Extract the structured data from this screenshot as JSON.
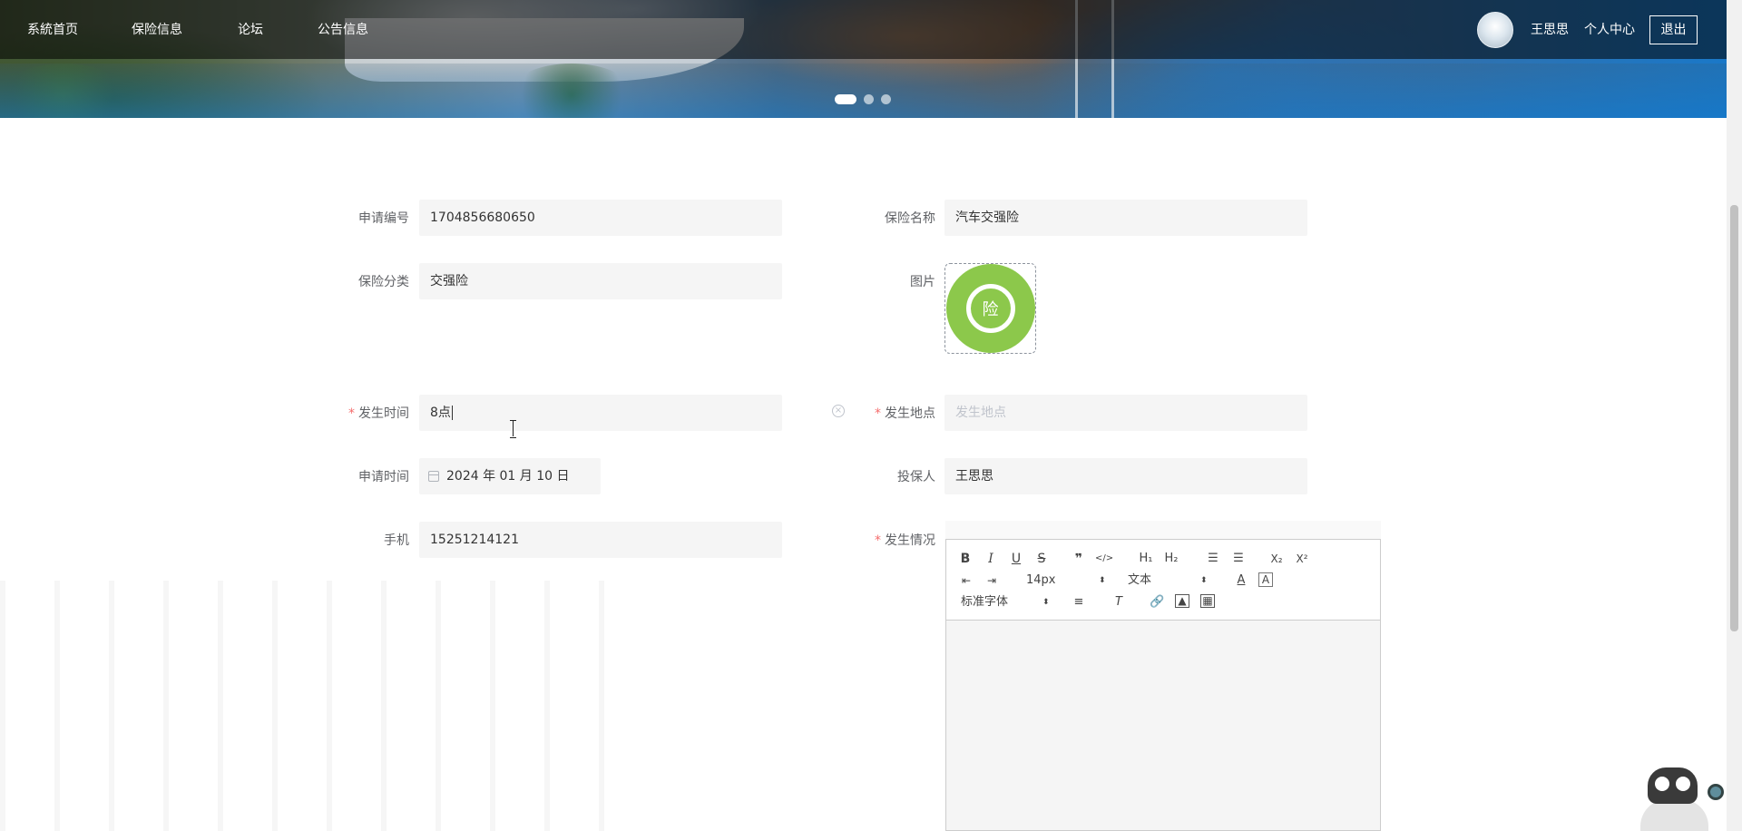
{
  "nav": {
    "items": [
      {
        "label": "系統首页"
      },
      {
        "label": "保险信息"
      },
      {
        "label": "论坛"
      },
      {
        "label": "公告信息"
      }
    ],
    "user_name": "王思思",
    "personal_center": "个人中心",
    "logout": "退出"
  },
  "carousel": {
    "slide_count": 3,
    "active_index": 0
  },
  "form": {
    "application_number": {
      "label": "申请编号",
      "value": "1704856680650"
    },
    "insurance_name": {
      "label": "保险名称",
      "value": "汽车交强险"
    },
    "insurance_category": {
      "label": "保险分类",
      "value": "交强险"
    },
    "image": {
      "label": "图片",
      "badge_text": "险",
      "color": "#8cc84b"
    },
    "occurrence_time": {
      "label": "发生时间",
      "value": "8点",
      "required": true
    },
    "occurrence_location": {
      "label": "发生地点",
      "placeholder": "发生地点",
      "required": true
    },
    "apply_time": {
      "label": "申请时间",
      "value": "2024 年 01 月 10 日"
    },
    "policyholder": {
      "label": "投保人",
      "value": "王思思"
    },
    "phone": {
      "label": "手机",
      "value": "15251214121"
    },
    "occurrence_details": {
      "label": "发生情况",
      "required": true
    }
  },
  "editor": {
    "font_size": "14px",
    "block_format": "文本",
    "font_family": "标准字体",
    "buttons": {
      "bold": "B",
      "italic": "I",
      "underline": "U",
      "strike": "S",
      "blockquote": "❞",
      "code": "</>",
      "h1": "H₁",
      "h2": "H₂",
      "subscript": "X₂",
      "superscript": "X²"
    }
  },
  "colors": {
    "required_star": "#f56c6c",
    "input_bg": "#f5f5f5",
    "nav_overlay": "rgba(0,0,0,0.55)"
  }
}
